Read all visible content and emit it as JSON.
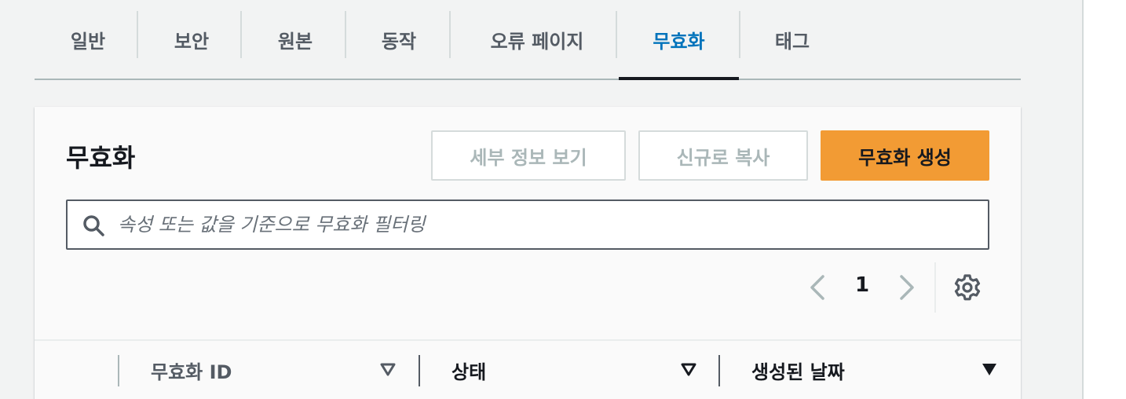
{
  "tabs": [
    {
      "label": "일반"
    },
    {
      "label": "보안"
    },
    {
      "label": "원본"
    },
    {
      "label": "동작"
    },
    {
      "label": "오류 페이지"
    },
    {
      "label": "무효화",
      "active": true
    },
    {
      "label": "태그"
    }
  ],
  "panel": {
    "title": "무효화",
    "buttons": {
      "view_details": "세부 정보 보기",
      "copy_new": "신규로 복사",
      "create": "무효화 생성"
    },
    "search": {
      "placeholder": "속성 또는 값을 기준으로 무효화 필터링",
      "value": ""
    },
    "pagination": {
      "current_page": "1"
    },
    "table": {
      "columns": [
        {
          "label": "무효화 ID",
          "sort": "descending-outline"
        },
        {
          "label": "상태",
          "sort": "descending-outline"
        },
        {
          "label": "생성된 날짜",
          "sort": "descending-filled"
        }
      ]
    }
  },
  "colors": {
    "accent": "#0073bb",
    "primary_button": "#f29b34",
    "text": "#16191f",
    "muted": "#545b64",
    "disabled": "#aab7b8"
  },
  "icons": [
    "search-icon",
    "chevron-left-icon",
    "chevron-right-icon",
    "settings-icon",
    "sort-down-icon"
  ]
}
